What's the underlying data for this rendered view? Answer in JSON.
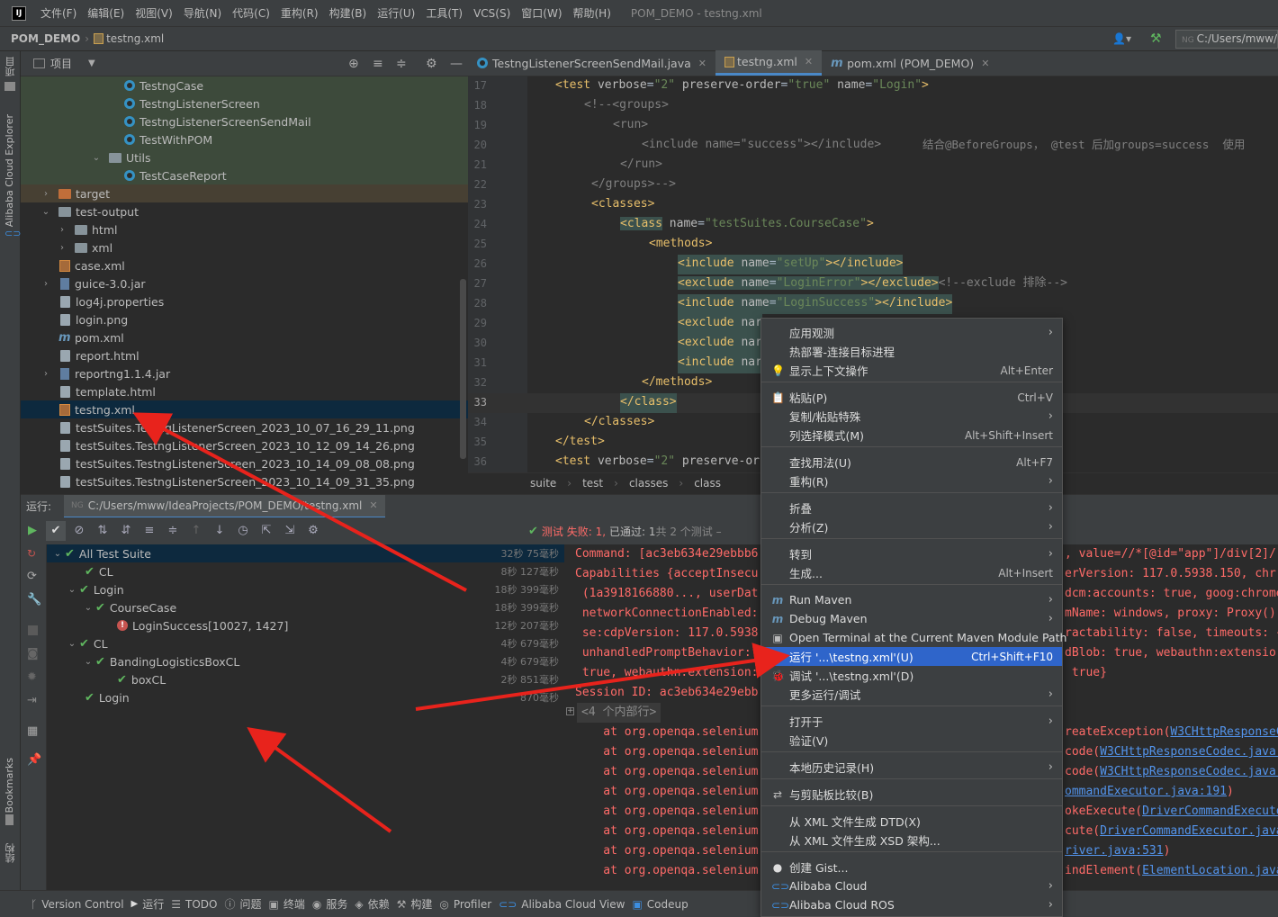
{
  "menubar": {
    "items": [
      "文件(F)",
      "编辑(E)",
      "视图(V)",
      "导航(N)",
      "代码(C)",
      "重构(R)",
      "构建(B)",
      "运行(U)",
      "工具(T)",
      "VCS(S)",
      "窗口(W)",
      "帮助(H)"
    ],
    "title": "POM_DEMO - testng.xml"
  },
  "navbar": {
    "project": "POM_DEMO",
    "file": "testng.xml",
    "path": "C:/Users/mww/"
  },
  "leftstrip": {
    "project": "项目",
    "cloud": "Alibaba Cloud Explorer",
    "bookmarks": "Bookmarks",
    "structure": "结构"
  },
  "projhdr": {
    "title": "项目"
  },
  "tree": [
    {
      "label": "TestngCase",
      "icon": "class"
    },
    {
      "label": "TestngListenerScreen",
      "icon": "class"
    },
    {
      "label": "TestngListenerScreenSendMail",
      "icon": "class"
    },
    {
      "label": "TestWithPOM",
      "icon": "class"
    },
    {
      "label": "Utils",
      "icon": "package"
    },
    {
      "label": "TestCaseReport",
      "icon": "class"
    },
    {
      "label": "target",
      "icon": "folder-orange"
    },
    {
      "label": "test-output",
      "icon": "folder"
    },
    {
      "label": "html",
      "icon": "folder"
    },
    {
      "label": "xml",
      "icon": "folder"
    },
    {
      "label": "case.xml",
      "icon": "xml"
    },
    {
      "label": "guice-3.0.jar",
      "icon": "jar"
    },
    {
      "label": "log4j.properties",
      "icon": "file"
    },
    {
      "label": "login.png",
      "icon": "file"
    },
    {
      "label": "pom.xml",
      "icon": "maven"
    },
    {
      "label": "report.html",
      "icon": "file"
    },
    {
      "label": "reportng1.1.4.jar",
      "icon": "jar"
    },
    {
      "label": "template.html",
      "icon": "file"
    },
    {
      "label": "testng.xml",
      "icon": "xml"
    },
    {
      "label": "testSuites.TestngListenerScreen_2023_10_07_16_29_11.png",
      "icon": "file"
    },
    {
      "label": "testSuites.TestngListenerScreen_2023_10_12_09_14_26.png",
      "icon": "file"
    },
    {
      "label": "testSuites.TestngListenerScreen_2023_10_14_09_08_08.png",
      "icon": "file"
    },
    {
      "label": "testSuites.TestngListenerScreen_2023_10_14_09_31_35.png",
      "icon": "file"
    }
  ],
  "tabs": [
    {
      "label": "TestngListenerScreenSendMail.java"
    },
    {
      "label": "testng.xml"
    },
    {
      "label": "pom.xml (POM_DEMO)"
    }
  ],
  "editor": {
    "line_numbers": [
      "17",
      "18",
      "19",
      "20",
      "21",
      "22",
      "23",
      "24",
      "25",
      "26",
      "27",
      "28",
      "29",
      "30",
      "31",
      "32",
      "33",
      "34",
      "35",
      "36"
    ],
    "l17": {
      "tag": "<test",
      "a1": " verbose",
      "v1": "\"2\"",
      "a2": " preserve-order",
      "v2": "\"true\"",
      "a3": " name",
      "v3": "\"Login\"",
      "end": ">"
    },
    "l18": "<!--<groups>",
    "l19": "<run>",
    "l20a": "<include name=\"success\"></include>",
    "l20b": "结合@BeforeGroups， @test 后加groups=success  使用",
    "l21": "</run>",
    "l22": "</groups>-->",
    "l23": "<classes>",
    "l24": {
      "tag": "<class",
      "a": " name",
      "v": "\"testSuites.CourseCase\"",
      "end": ">"
    },
    "l25": "<methods>",
    "l26": {
      "tag": "<include",
      "a": " name",
      "v": "\"setUp\"",
      "end": "></include>"
    },
    "l27": {
      "tag": "<exclude",
      "a": " name",
      "v": "\"LoginError\"",
      "end": "></exclude>",
      "cm": "<!--exclude 排除-->"
    },
    "l28": {
      "tag": "<include",
      "a": " name",
      "v": "\"LoginSuccess\"",
      "end": "></include>"
    },
    "l29": {
      "tag": "<exclude",
      "a": " nar"
    },
    "l30": {
      "tag": "<exclude",
      "a": " nar"
    },
    "l31": {
      "tag": "<include",
      "a": " nar"
    },
    "l32": "</methods>",
    "l33": "</class>",
    "l34": "</classes>",
    "l35": "</test>",
    "l36": {
      "tag": "<test",
      "a1": " verbose",
      "v1": "\"2\"",
      "a2": " preserve-or"
    }
  },
  "breadcrumb": [
    "suite",
    "test",
    "classes",
    "class"
  ],
  "runbar": {
    "label": "运行:",
    "config": "C:/Users/mww/IdeaProjects/POM_DEMO/testng.xml"
  },
  "status_summary": {
    "failed": "测试 失败: 1,",
    "passed": "已通过: 1",
    "total": "共 2 个测试 –"
  },
  "tests": [
    {
      "label": "All Test Suite",
      "time": "32秒 75毫秒"
    },
    {
      "label": "CL",
      "time": "8秒 127毫秒"
    },
    {
      "label": "Login",
      "time": "18秒 399毫秒"
    },
    {
      "label": "CourseCase",
      "time": "18秒 399毫秒"
    },
    {
      "label": "LoginSuccess[10027, 1427]",
      "time": "12秒 207毫秒"
    },
    {
      "label": "CL",
      "time": "4秒 679毫秒"
    },
    {
      "label": "BandingLogisticsBoxCL",
      "time": "4秒 679毫秒"
    },
    {
      "label": "boxCL",
      "time": "2秒 851毫秒"
    },
    {
      "label": "Login",
      "time": "870毫秒"
    }
  ],
  "console": {
    "l1a": "Command: [ac3eb634e29ebbb6",
    "l1b": ", value=//*[@id=\"app\"]/div[2]/",
    "l2a": "Capabilities {acceptInsecu",
    "l2b": "erVersion: 117.0.5938.150, chr",
    "l3a": " (1a3918166880..., userDat",
    "l3b": "dcm:accounts: true, goog:chrome",
    "l4a": " networkConnectionEnabled:",
    "l4b": "mName: windows, proxy: Proxy(),",
    "l5a": " se:cdpVersion: 117.0.5938",
    "l5b": "ractability: false, timeouts: {",
    "l6a": " unhandledPromptBehavior: ",
    "l6b": "dBlob: true, webauthn:extensio",
    "l7a": " true, webauthn:extension:",
    "l7b": " true}",
    "l8": "Session ID: ac3eb634e29ebb",
    "l9": "<4 个内部行>",
    "at": "    at org.openqa.selenium",
    "r10": "reateException(",
    "r10u": "W3CHttpResponseCo",
    "r11": "code(",
    "r11u": "W3CHttpResponseCodec.java:",
    "r12": "code(",
    "r12u": "W3CHttpResponseCodec.java:",
    "r13u": "ommandExecutor.java:191",
    "r14": "okeExecute(",
    "r14u": "DriverCommandExecuto",
    "r15": "cute(",
    "r15u": "DriverCommandExecutor.java",
    "r16u": "river.java:531",
    "r17": "indElement(",
    "r17u": "ElementLocation.java"
  },
  "statusbar": [
    "Version Control",
    "运行",
    "TODO",
    "问题",
    "终端",
    "服务",
    "依赖",
    "构建",
    "Profiler",
    "Alibaba Cloud View",
    "Codeup"
  ],
  "context_menu": {
    "items": [
      {
        "label": "应用观测",
        "shortcut": "",
        "submenu": true
      },
      {
        "label": "热部署-连接目标进程",
        "shortcut": "",
        "submenu": false
      },
      {
        "label": "显示上下文操作",
        "shortcut": "Alt+Enter",
        "submenu": false,
        "icon": "bulb-icon"
      },
      {
        "label": "粘贴(P)",
        "shortcut": "Ctrl+V",
        "submenu": false,
        "icon": "paste-icon"
      },
      {
        "label": "复制/粘贴特殊",
        "shortcut": "",
        "submenu": true
      },
      {
        "label": "列选择模式(M)",
        "shortcut": "Alt+Shift+Insert",
        "submenu": false
      },
      {
        "label": "查找用法(U)",
        "shortcut": "Alt+F7",
        "submenu": false
      },
      {
        "label": "重构(R)",
        "shortcut": "",
        "submenu": true
      },
      {
        "label": "折叠",
        "shortcut": "",
        "submenu": true
      },
      {
        "label": "分析(Z)",
        "shortcut": "",
        "submenu": true
      },
      {
        "label": "转到",
        "shortcut": "",
        "submenu": true
      },
      {
        "label": "生成...",
        "shortcut": "Alt+Insert",
        "submenu": false
      },
      {
        "label": "Run Maven",
        "shortcut": "",
        "submenu": true,
        "icon": "maven-icon"
      },
      {
        "label": "Debug Maven",
        "shortcut": "",
        "submenu": true,
        "icon": "maven-icon"
      },
      {
        "label": "Open Terminal at the Current Maven Module Path",
        "shortcut": "",
        "submenu": false,
        "icon": "terminal-icon"
      },
      {
        "label": "运行 '...\\testng.xml'(U)",
        "shortcut": "Ctrl+Shift+F10",
        "submenu": false,
        "icon": "run-icon"
      },
      {
        "label": "调试 '...\\testng.xml'(D)",
        "shortcut": "",
        "submenu": false,
        "icon": "debug-icon"
      },
      {
        "label": "更多运行/调试",
        "shortcut": "",
        "submenu": true
      },
      {
        "label": "打开于",
        "shortcut": "",
        "submenu": true
      },
      {
        "label": "验证(V)",
        "shortcut": "",
        "submenu": false
      },
      {
        "label": "本地历史记录(H)",
        "shortcut": "",
        "submenu": true
      },
      {
        "label": "与剪贴板比较(B)",
        "shortcut": "",
        "submenu": false,
        "icon": "compare-icon"
      },
      {
        "label": "从 XML 文件生成 DTD(X)",
        "shortcut": "",
        "submenu": false
      },
      {
        "label": "从 XML 文件生成 XSD 架构...",
        "shortcut": "",
        "submenu": false
      },
      {
        "label": "创建 Gist...",
        "shortcut": "",
        "submenu": false,
        "icon": "github-icon"
      },
      {
        "label": "Alibaba Cloud",
        "shortcut": "",
        "submenu": true,
        "icon": "cloud-icon"
      },
      {
        "label": "Alibaba Cloud ROS",
        "shortcut": "",
        "submenu": true,
        "icon": "cloud-icon"
      }
    ],
    "highlighted": "运行 '...\\testng.xml'(U)"
  },
  "colors": {
    "accent": "#2f65ca",
    "arrow": "#e8231c",
    "pass": "#5fb65f",
    "fail": "#c75450"
  }
}
